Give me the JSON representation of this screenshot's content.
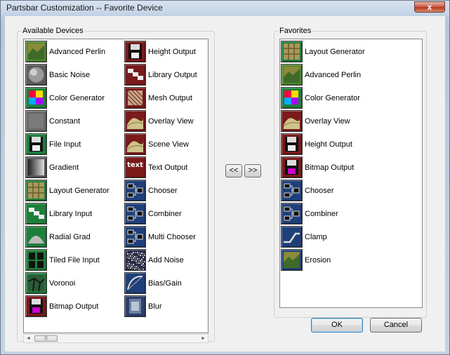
{
  "window": {
    "title": "Partsbar Customization -- Favorite Device",
    "close_glyph": "x"
  },
  "available": {
    "label": "Available Devices",
    "left_column": [
      {
        "label": "Advanced Perlin",
        "icon": "advanced-perlin-icon"
      },
      {
        "label": "Basic Noise",
        "icon": "basic-noise-icon"
      },
      {
        "label": "Color Generator",
        "icon": "color-generator-icon"
      },
      {
        "label": "Constant",
        "icon": "constant-icon"
      },
      {
        "label": "File Input",
        "icon": "file-input-icon"
      },
      {
        "label": "Gradient",
        "icon": "gradient-icon"
      },
      {
        "label": "Layout Generator",
        "icon": "layout-generator-icon"
      },
      {
        "label": "Library Input",
        "icon": "library-input-icon"
      },
      {
        "label": "Radial Grad",
        "icon": "radial-grad-icon"
      },
      {
        "label": "Tiled File Input",
        "icon": "tiled-file-input-icon"
      },
      {
        "label": "Voronoi",
        "icon": "voronoi-icon"
      },
      {
        "label": "Bitmap Output",
        "icon": "bitmap-output-icon"
      }
    ],
    "right_column": [
      {
        "label": "Height Output",
        "icon": "height-output-icon"
      },
      {
        "label": "Library Output",
        "icon": "library-output-icon"
      },
      {
        "label": "Mesh Output",
        "icon": "mesh-output-icon"
      },
      {
        "label": "Overlay View",
        "icon": "overlay-view-icon"
      },
      {
        "label": "Scene View",
        "icon": "scene-view-icon"
      },
      {
        "label": "Text Output",
        "icon": "text-output-icon"
      },
      {
        "label": "Chooser",
        "icon": "chooser-icon"
      },
      {
        "label": "Combiner",
        "icon": "combiner-icon"
      },
      {
        "label": "Multi Chooser",
        "icon": "multi-chooser-icon"
      },
      {
        "label": "Add Noise",
        "icon": "add-noise-icon"
      },
      {
        "label": "Bias/Gain",
        "icon": "bias-gain-icon"
      },
      {
        "label": "Blur",
        "icon": "blur-icon"
      }
    ],
    "scroll_left_glyph": "◄",
    "scroll_right_glyph": "►",
    "scroll_thumb_glyph": "|||"
  },
  "favorites": {
    "label": "Favorites",
    "items": [
      {
        "label": "Layout Generator",
        "icon": "layout-generator-icon"
      },
      {
        "label": "Advanced Perlin",
        "icon": "advanced-perlin-icon"
      },
      {
        "label": "Color Generator",
        "icon": "color-generator-icon"
      },
      {
        "label": "Overlay View",
        "icon": "overlay-view-icon"
      },
      {
        "label": "Height Output",
        "icon": "height-output-icon"
      },
      {
        "label": "Bitmap Output",
        "icon": "bitmap-output-icon"
      },
      {
        "label": "Chooser",
        "icon": "chooser-icon"
      },
      {
        "label": "Combiner",
        "icon": "combiner-icon"
      },
      {
        "label": "Clamp",
        "icon": "clamp-icon"
      },
      {
        "label": "Erosion",
        "icon": "erosion-icon"
      }
    ]
  },
  "buttons": {
    "move_left": "<<",
    "move_right": ">>",
    "ok": "OK",
    "cancel": "Cancel"
  },
  "icon_styles": {
    "advanced-perlin-icon": "#4f8a2e",
    "basic-noise-icon": "#5a5a5a",
    "color-generator-icon": "#1e7f3b",
    "constant-icon": "#6a6a6a",
    "file-input-icon": "#1e7f3b",
    "gradient-icon": "#5a5a5a",
    "layout-generator-icon": "#1e7f3b",
    "library-input-icon": "#1e7f3b",
    "radial-grad-icon": "#1e7f3b",
    "tiled-file-input-icon": "#1e7f3b",
    "voronoi-icon": "#1e7f3b",
    "bitmap-output-icon": "#7a1a1a",
    "height-output-icon": "#7a1a1a",
    "library-output-icon": "#7a1a1a",
    "mesh-output-icon": "#7a1a1a",
    "overlay-view-icon": "#7a1a1a",
    "scene-view-icon": "#7a1a1a",
    "text-output-icon": "#7a1a1a",
    "chooser-icon": "#1f3f7a",
    "combiner-icon": "#1f3f7a",
    "multi-chooser-icon": "#1f3f7a",
    "add-noise-icon": "#2a2a4a",
    "bias-gain-icon": "#1f3f7a",
    "blur-icon": "#2a3f6a",
    "clamp-icon": "#1f3f7a",
    "erosion-icon": "#1f3f7a"
  }
}
